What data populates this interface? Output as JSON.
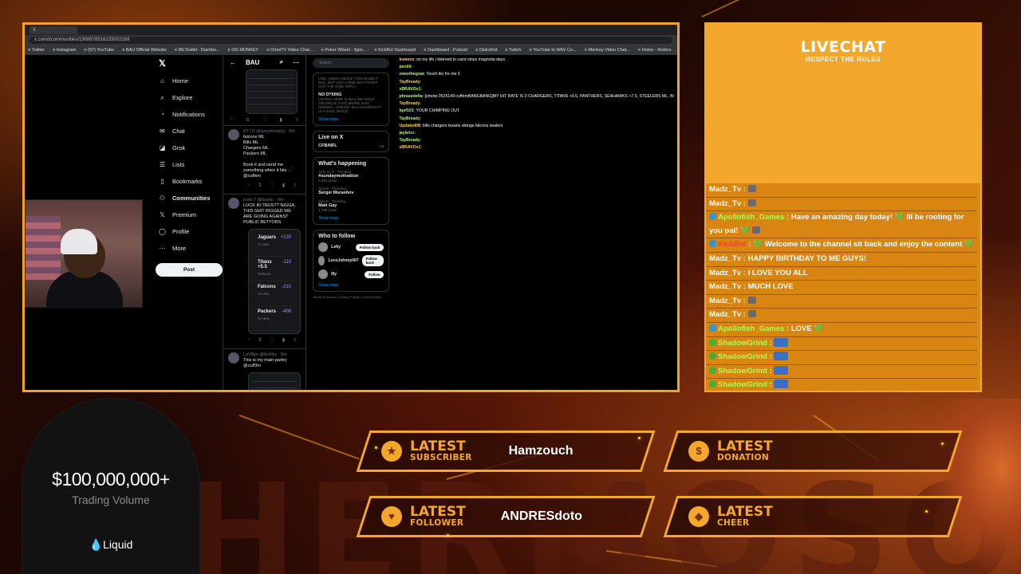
{
  "browser": {
    "tab_label": "X",
    "url": "x.com/i/communities/1908678516233002169",
    "bookmarks": [
      "Twitter",
      "Instagram",
      "(57) YouTube",
      "BAU Official Website",
      "IBLToolkit - Dashbo...",
      "OG MONKEY",
      "OmniTV Video Chat...",
      "Poker Wheel - Spin...",
      "KickBot Dashboard",
      "Dashboard - Pulsoid",
      "DistroKid",
      "Twitch",
      "YouTube to WAV Co...",
      "Monkey Video Chat...",
      "Home - Roblox"
    ]
  },
  "x_nav": {
    "items": [
      {
        "icon": "home-icon",
        "label": "Home"
      },
      {
        "icon": "search-icon",
        "label": "Explore"
      },
      {
        "icon": "bell-icon",
        "label": "Notifications"
      },
      {
        "icon": "chat-icon",
        "label": "Chat"
      },
      {
        "icon": "grok-icon",
        "label": "Grok"
      },
      {
        "icon": "list-icon",
        "label": "Lists"
      },
      {
        "icon": "bookmark-icon",
        "label": "Bookmarks"
      },
      {
        "icon": "communities-icon",
        "label": "Communities"
      },
      {
        "icon": "premium-icon",
        "label": "Premium"
      },
      {
        "icon": "profile-icon",
        "label": "Profile"
      },
      {
        "icon": "more-icon",
        "label": "More"
      }
    ],
    "post_label": "Post"
  },
  "x_main": {
    "title": "BAU",
    "posts": [
      {
        "handle": "87 | D @azxymoneyy · 9m",
        "lines": [
          "falcons ML",
          "Bills ML",
          "Chargers ML",
          "Packers ML",
          "",
          "Book it and send me something when it hits .. @cuffem"
        ]
      },
      {
        "handle": "justo ? @bjusto · 9m",
        "lines": [
          "LOCK IN TRUST? NIGGA, THIS SHIT RIGGED WE ARE GOING AGAINST",
          "PUBLIC BETTORS"
        ],
        "picks": [
          {
            "team": "Jaguars",
            "sub": "TO WIN",
            "odds": "+130"
          },
          {
            "team": "Titans +5.5",
            "sub": "SPREAD",
            "odds": "-110"
          },
          {
            "team": "Falcons",
            "sub": "TO WIN",
            "odds": "-210"
          },
          {
            "team": "Packers",
            "sub": "TO WIN",
            "odds": "-400"
          }
        ]
      },
      {
        "handle": "LaVillys @lavillys · 9m",
        "lines": [
          "This is my main parley @cuff3m"
        ]
      }
    ]
  },
  "x_right": {
    "search_placeholder": "Search",
    "rules_text": "LINK, VIDEO, IMAGE, YOU NAME IT WILL GET YOU A ONE WAY TICKET OUT THE COM. STFU.",
    "rule_title": "NO D*XING",
    "rule_body": "LISTEN, HERE AT BAU WE DONT TOLERATE THAT WEIRD SHIT. DOXING = EXILED. BAU UNIVERSITY IS A SAFE SPACE",
    "show_more": "Show more",
    "live_title": "Live on X",
    "live_item": "CFB/NFL",
    "live_count": "+34",
    "happening_title": "What's happening",
    "trends": [
      {
        "meta": "Only on X · Trending",
        "name": "#sundaymotivation",
        "count": "5,354 posts"
      },
      {
        "meta": "Sports · Trending",
        "name": "Sergei Murashov",
        "count": ""
      },
      {
        "meta": "Sports · Trending",
        "name": "Matt Gay",
        "count": "1,768 posts"
      }
    ],
    "follow_title": "Who to follow",
    "follows": [
      {
        "name": "Lefty",
        "btn": "Follow back"
      },
      {
        "name": "LocoJohnny007",
        "btn": "Follow back"
      },
      {
        "name": "Illy",
        "btn": "Follow"
      }
    ],
    "footer": "Terms of Service  |  Privacy Policy  |  Cookie Policy"
  },
  "mini_chat": [
    {
      "user": "kuwenz",
      "text": "on my life i listened to carol since magnolia days"
    },
    {
      "user": "penilit",
      "text": ""
    },
    {
      "user": "zweethegoat",
      "text": "Touch tiio for me 5"
    },
    {
      "user": "TayBready",
      "text": ""
    },
    {
      "user": "xBRAVOx1",
      "text": ""
    },
    {
      "user": "phrasedelta",
      "text": "[emote:3525140:cuffemBANGBANG]MY HIT RATE IS 0 CHARGERS, TITANS +9.5, PANTHERS, SEAHAWKS +7.5, STEELERS ML, BI"
    },
    {
      "user": "TayBready",
      "text": ""
    },
    {
      "user": "lqof101",
      "text": "YOUR CHIMPING OUT"
    },
    {
      "user": "TayBready",
      "text": ""
    },
    {
      "user": "Updated08",
      "text": "bills chargers texans vikings falcons sealers"
    },
    {
      "user": "jaybrizz",
      "text": ""
    },
    {
      "user": "TayBready",
      "text": ""
    },
    {
      "user": "xBRAVOx1",
      "text": ""
    }
  ],
  "livechat": {
    "title": "LIVECHAT",
    "subtitle": "RESPECT THE RULES",
    "messages": [
      {
        "user": "Madz_Tv",
        "text": "",
        "kind": "m",
        "badge": false,
        "emote": "sm"
      },
      {
        "user": "Madz_Tv",
        "text": "",
        "kind": "m",
        "badge": false,
        "emote": "sm"
      },
      {
        "user": "Apollofish_Games",
        "text": "Have an amazing day today! 💚 Ill be rooting for you pal! 💚",
        "kind": "a",
        "badge": true,
        "emote": "sm"
      },
      {
        "user": "KickBot",
        "text": "💚 Welcome to the channel sit back and enjoy the content 💚",
        "kind": "k",
        "badge": true,
        "emote": ""
      },
      {
        "user": "Madz_Tv",
        "text": "HAPPY BIRTHDAY TO ME GUYS!",
        "kind": "m",
        "badge": false,
        "emote": ""
      },
      {
        "user": "Madz_Tv",
        "text": "I LOVE YOU ALL",
        "kind": "m",
        "badge": false,
        "emote": ""
      },
      {
        "user": "Madz_Tv",
        "text": "MUCH LOVE",
        "kind": "m",
        "badge": false,
        "emote": ""
      },
      {
        "user": "Madz_Tv",
        "text": "",
        "kind": "m",
        "badge": false,
        "emote": "sm"
      },
      {
        "user": "Madz_Tv",
        "text": "",
        "kind": "m",
        "badge": false,
        "emote": "sm"
      },
      {
        "user": "Apollofish_Games",
        "text": "LOVE 💚",
        "kind": "a",
        "badge": true,
        "emote": ""
      },
      {
        "user": "ShadowGrind",
        "text": "",
        "kind": "s",
        "badge": true,
        "emote": "big"
      },
      {
        "user": "ShadowGrind",
        "text": "",
        "kind": "s",
        "badge": true,
        "emote": "big"
      },
      {
        "user": "ShadowGrind",
        "text": "",
        "kind": "s",
        "badge": true,
        "emote": "big"
      },
      {
        "user": "ShadowGrind",
        "text": "",
        "kind": "s",
        "badge": true,
        "emote": "big"
      },
      {
        "user": "ShadowGrind",
        "text": "",
        "kind": "s",
        "badge": true,
        "emote": "big"
      }
    ]
  },
  "sponsor": {
    "amount": "$100,000,000+",
    "label": "Trading Volume",
    "brand": "Liquid"
  },
  "alerts": {
    "subscriber": {
      "line1": "LATEST",
      "line2": "SUBSCRIBER",
      "value": "Hamzouch",
      "icon": "star-icon"
    },
    "donation": {
      "line1": "LATEST",
      "line2": "DONATION",
      "value": "",
      "icon": "dollar-icon"
    },
    "follower": {
      "line1": "LATEST",
      "line2": "FOLLOWER",
      "value": "ANDRESdoto",
      "icon": "heart-icon"
    },
    "cheer": {
      "line1": "LATEST",
      "line2": "CHEER",
      "value": "",
      "icon": "gem-icon"
    }
  },
  "colors": {
    "accent": "#f3a82d",
    "chat_bg": "#d98a16",
    "green": "#a8ff57"
  }
}
